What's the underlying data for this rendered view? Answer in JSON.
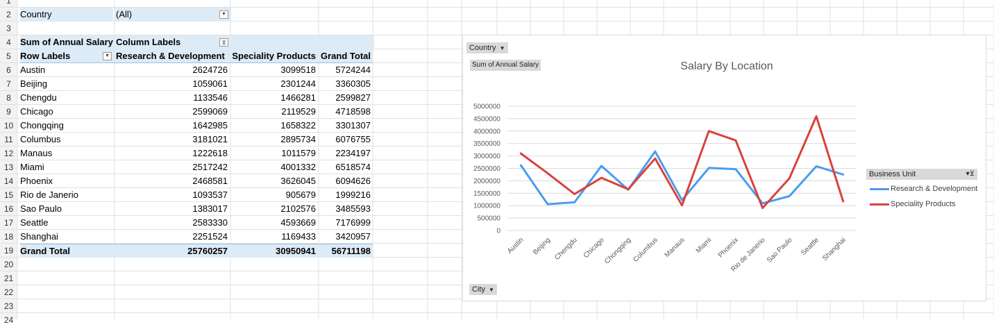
{
  "filter": {
    "label": "Country",
    "value": "(All)"
  },
  "pivot": {
    "value_header": "Sum of Annual Salary",
    "column_labels": "Column Labels",
    "row_labels": "Row Labels",
    "columns": [
      "Research & Development",
      "Speciality Products",
      "Grand Total"
    ],
    "rows": [
      {
        "city": "Austin",
        "rd": "2624726",
        "sp": "3099518",
        "gt": "5724244"
      },
      {
        "city": "Beijing",
        "rd": "1059061",
        "sp": "2301244",
        "gt": "3360305"
      },
      {
        "city": "Chengdu",
        "rd": "1133546",
        "sp": "1466281",
        "gt": "2599827"
      },
      {
        "city": "Chicago",
        "rd": "2599069",
        "sp": "2119529",
        "gt": "4718598"
      },
      {
        "city": "Chongqing",
        "rd": "1642985",
        "sp": "1658322",
        "gt": "3301307"
      },
      {
        "city": "Columbus",
        "rd": "3181021",
        "sp": "2895734",
        "gt": "6076755"
      },
      {
        "city": "Manaus",
        "rd": "1222618",
        "sp": "1011579",
        "gt": "2234197"
      },
      {
        "city": "Miami",
        "rd": "2517242",
        "sp": "4001332",
        "gt": "6518574"
      },
      {
        "city": "Phoenix",
        "rd": "2468581",
        "sp": "3626045",
        "gt": "6094626"
      },
      {
        "city": "Rio de Janerio",
        "rd": "1093537",
        "sp": "905679",
        "gt": "1999216"
      },
      {
        "city": "Sao Paulo",
        "rd": "1383017",
        "sp": "2102576",
        "gt": "3485593"
      },
      {
        "city": "Seattle",
        "rd": "2583330",
        "sp": "4593669",
        "gt": "7176999"
      },
      {
        "city": "Shanghai",
        "rd": "2251524",
        "sp": "1169433",
        "gt": "3420957"
      }
    ],
    "grand_total": {
      "label": "Grand Total",
      "rd": "25760257",
      "sp": "30950941",
      "gt": "56711198"
    }
  },
  "row_numbers": [
    "1",
    "2",
    "3",
    "4",
    "5",
    "6",
    "7",
    "8",
    "9",
    "10",
    "11",
    "12",
    "13",
    "14",
    "15",
    "16",
    "17",
    "18",
    "19",
    "20",
    "21",
    "22",
    "23",
    "24"
  ],
  "chart": {
    "filter_button": "Country",
    "value_button": "Sum of Annual Salary",
    "axis_button": "City",
    "legend_title": "Business Unit"
  },
  "chart_data": {
    "type": "line",
    "title": "Salary By Location",
    "categories": [
      "Austin",
      "Beijing",
      "Chengdu",
      "Chicago",
      "Chongqing",
      "Columbus",
      "Manaus",
      "Miami",
      "Phoenix",
      "Rio de Janerio",
      "Sao Paulo",
      "Seattle",
      "Shanghai"
    ],
    "series": [
      {
        "name": "Research & Development",
        "color": "#4a9cf0",
        "values": [
          2624726,
          1059061,
          1133546,
          2599069,
          1642985,
          3181021,
          1222618,
          2517242,
          2468581,
          1093537,
          1383017,
          2583330,
          2251524
        ]
      },
      {
        "name": "Speciality Products",
        "color": "#d9423a",
        "values": [
          3099518,
          2301244,
          1466281,
          2119529,
          1658322,
          2895734,
          1011579,
          4001332,
          3626045,
          905679,
          2102576,
          4593669,
          1169433
        ]
      }
    ],
    "ylim": [
      0,
      5000000
    ],
    "yticks": [
      "5000000",
      "4500000",
      "4000000",
      "3500000",
      "3000000",
      "2500000",
      "2000000",
      "1500000",
      "1000000",
      "500000",
      "0"
    ],
    "grid": true,
    "legend_position": "right"
  }
}
